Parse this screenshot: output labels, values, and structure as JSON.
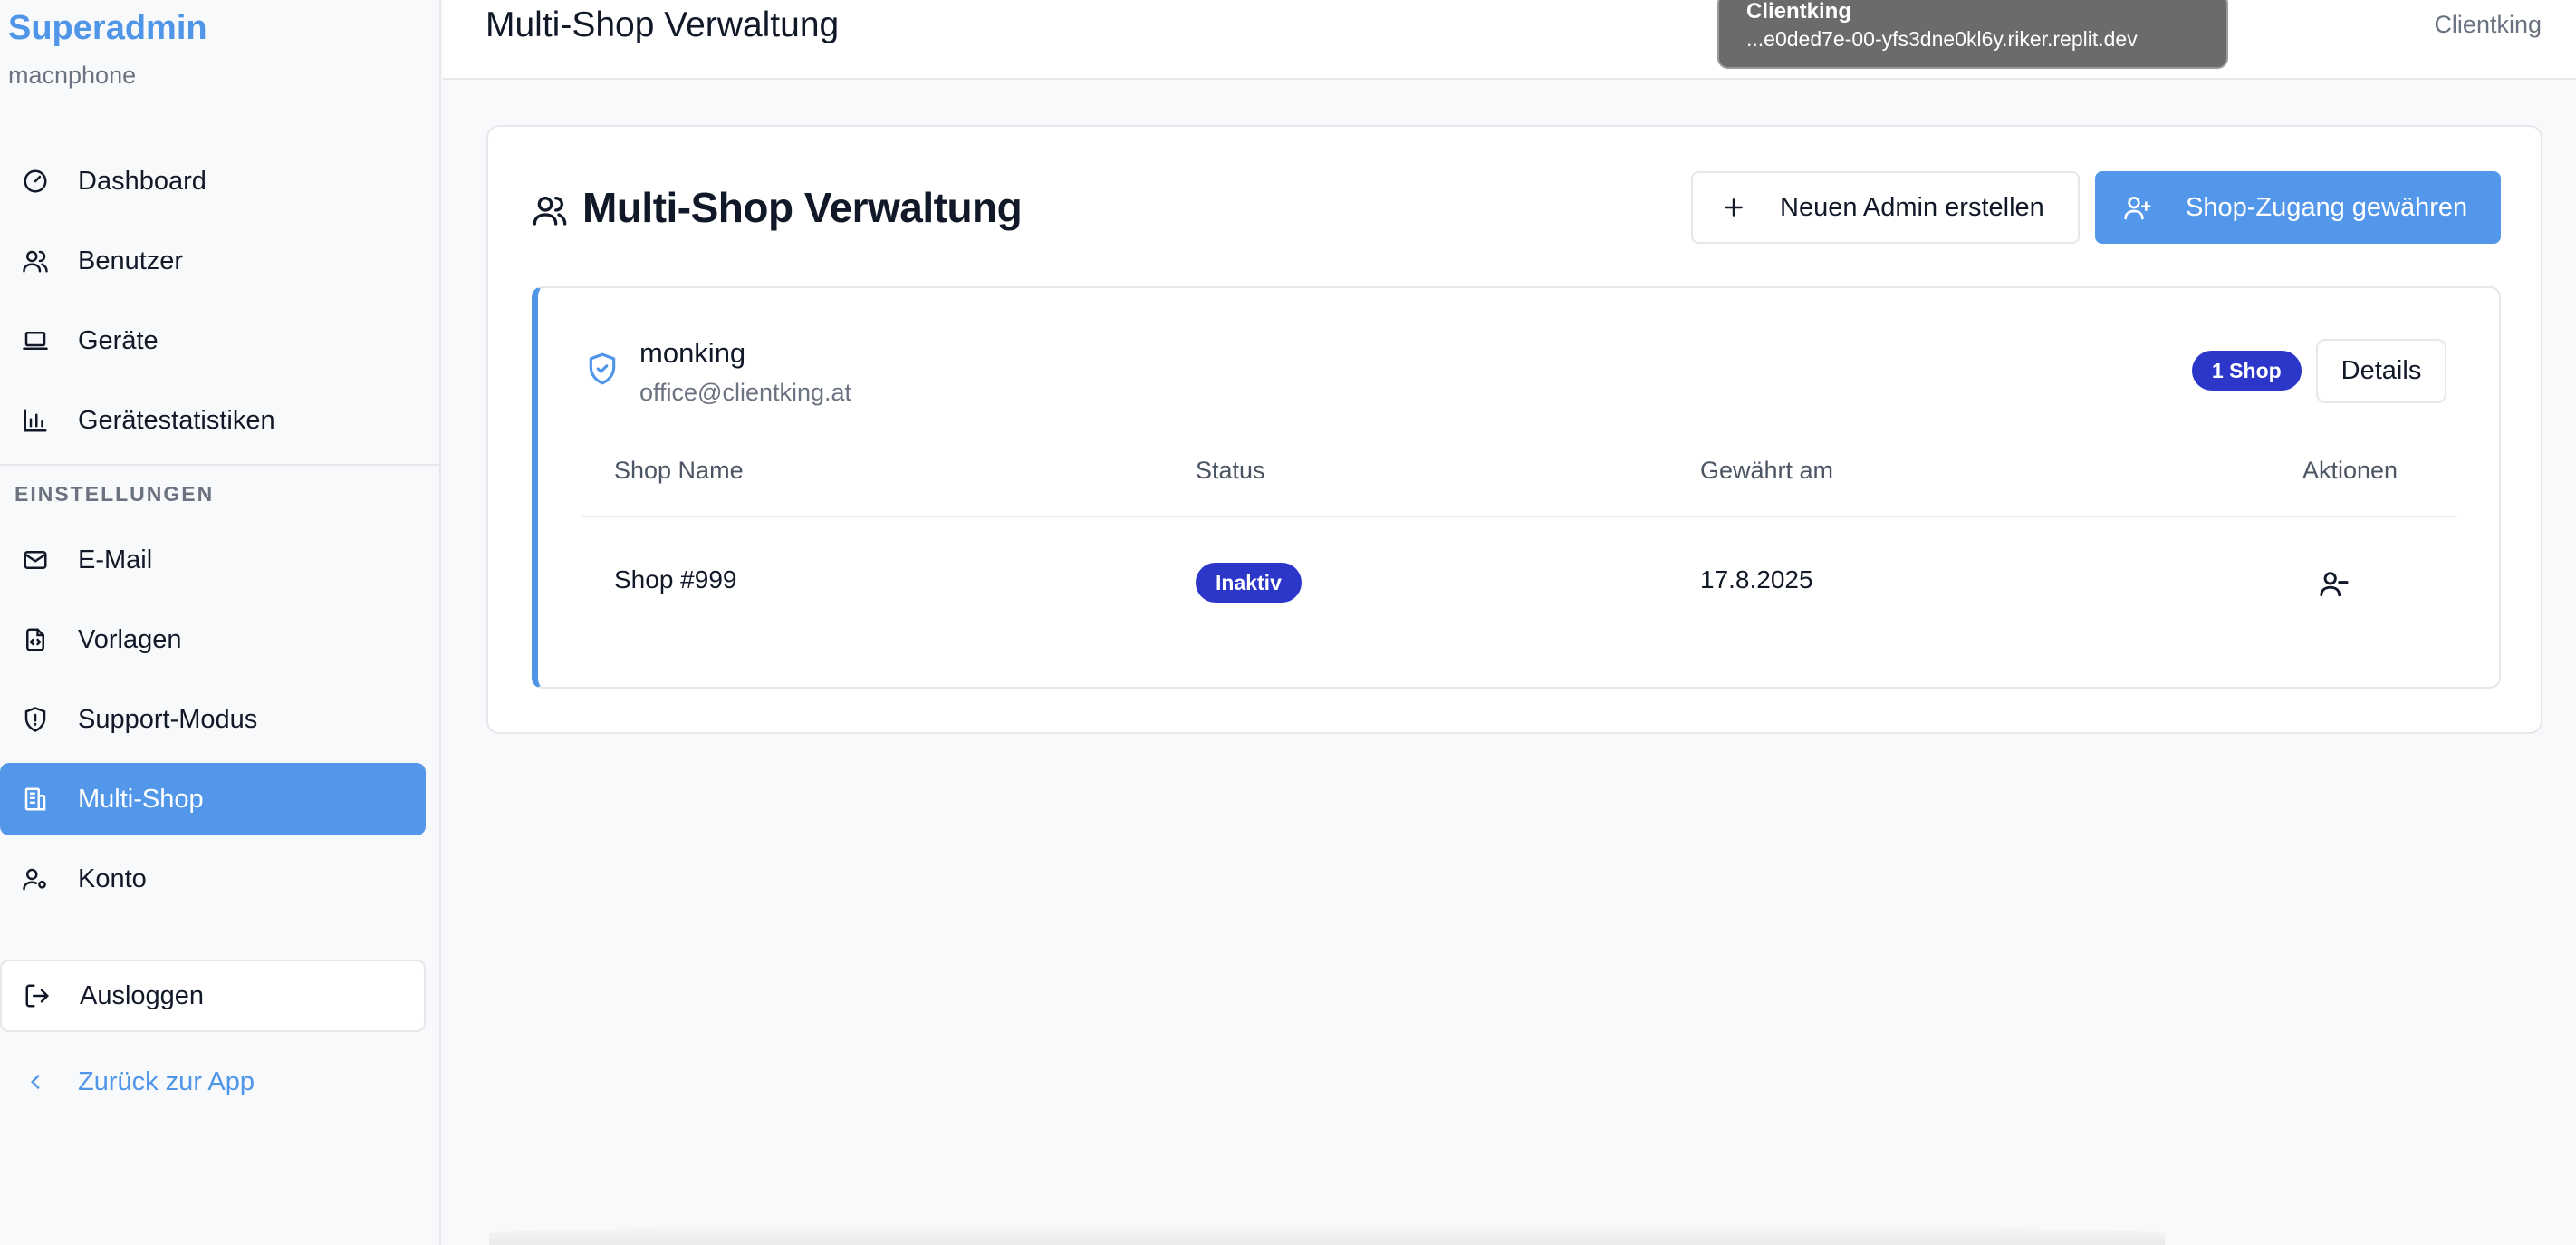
{
  "sidebar": {
    "brand_title": "Superadmin",
    "brand_subtitle": "macnphone",
    "items": [
      {
        "label": "Dashboard",
        "icon": "gauge-icon"
      },
      {
        "label": "Benutzer",
        "icon": "users-icon"
      },
      {
        "label": "Geräte",
        "icon": "laptop-icon"
      },
      {
        "label": "Gerätestatistiken",
        "icon": "bar-chart-icon"
      }
    ],
    "section_label": "EINSTELLUNGEN",
    "settings_items": [
      {
        "label": "E-Mail",
        "icon": "mail-icon"
      },
      {
        "label": "Vorlagen",
        "icon": "file-code-icon"
      },
      {
        "label": "Support-Modus",
        "icon": "shield-alert-icon"
      },
      {
        "label": "Multi-Shop",
        "icon": "building-icon",
        "active": true
      },
      {
        "label": "Konto",
        "icon": "user-cog-icon"
      }
    ],
    "logout_label": "Ausloggen",
    "back_label": "Zurück zur App"
  },
  "header": {
    "title": "Multi-Shop Verwaltung",
    "right_text": "Clientking"
  },
  "tooltip": {
    "title": "Clientking",
    "url": "...e0ded7e-00-yfs3dne0kl6y.riker.replit.dev"
  },
  "main": {
    "title": "Multi-Shop Verwaltung",
    "new_admin_label": "Neuen Admin erstellen",
    "grant_access_label": "Shop-Zugang gewähren",
    "admin": {
      "name": "monking",
      "email": "office@clientking.at",
      "shop_badge": "1 Shop",
      "details_label": "Details"
    },
    "table": {
      "headers": [
        "Shop Name",
        "Status",
        "Gewährt am",
        "Aktionen"
      ],
      "rows": [
        {
          "shop_name": "Shop #999",
          "status": "Inaktiv",
          "granted": "17.8.2025"
        }
      ]
    }
  },
  "colors": {
    "accent": "#4f95e8",
    "active_nav": "#5397ea",
    "badge": "#2c36c8"
  }
}
